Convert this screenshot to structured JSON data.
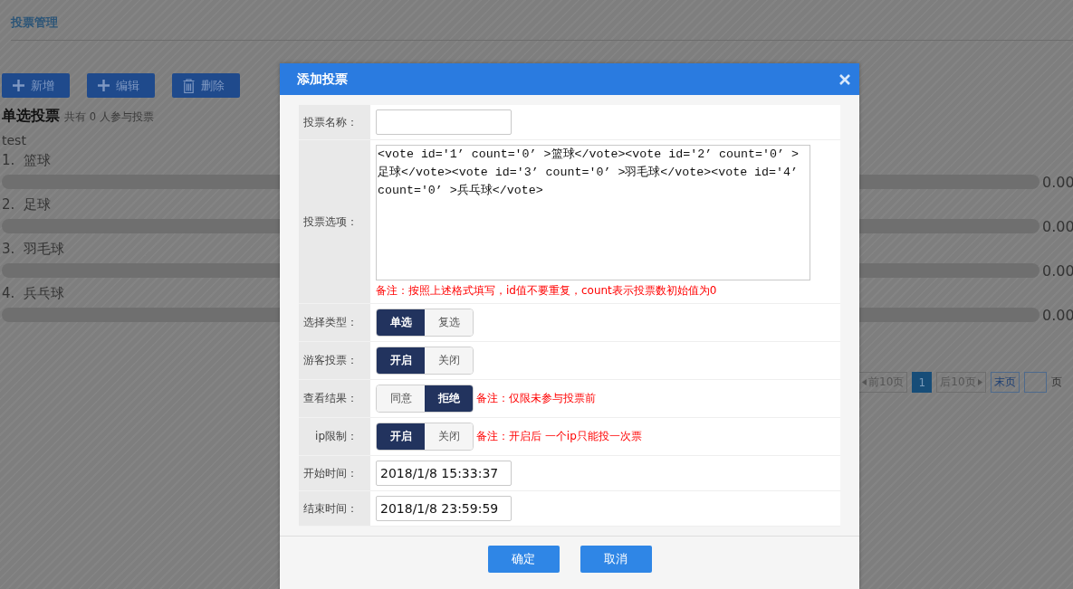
{
  "page": {
    "title": "投票管理"
  },
  "toolbar": [
    {
      "label": "新增",
      "kind": "add"
    },
    {
      "label": "编辑",
      "kind": "add"
    },
    {
      "label": "删除",
      "kind": "delete"
    }
  ],
  "poll": {
    "title": "单选投票",
    "summary": "共有 0 人参与投票",
    "name": "test",
    "options": [
      {
        "label": "1.  篮球",
        "level": 0,
        "reading": "0.00"
      },
      {
        "label": "2.  足球",
        "level": 0,
        "reading": "0.00"
      },
      {
        "label": "3.  羽毛球",
        "level": 0,
        "reading": "0.00"
      },
      {
        "label": "4.  兵乓球",
        "level": 0,
        "reading": "0.00"
      }
    ]
  },
  "pagination": {
    "prev": "前10页",
    "pages": [
      {
        "label": "1",
        "selected": true
      }
    ],
    "next": "后10页",
    "last": "末页",
    "suffix": "页"
  },
  "dialog": {
    "title": "添加投票",
    "fields": [
      {
        "kind": "text",
        "label": "投票名称："
      },
      {
        "kind": "textarea",
        "label": "投票选项：",
        "value": "<vote id='1’ count='0’ >篮球</vote><vote id='2’ count='0’ >足球</vote><vote id='3’ count='0’ >羽毛球</vote><vote id='4’ count='0’ >兵乓球</vote>",
        "note": "备注：按照上述格式填写，id值不要重复，count表示投票数初始值为0"
      },
      {
        "kind": "toggle",
        "label": "选择类型：",
        "options": [
          {
            "label": "单选",
            "selected": true
          },
          {
            "label": "复选",
            "selected": false
          }
        ]
      },
      {
        "kind": "toggle",
        "label": "游客投票：",
        "options": [
          {
            "label": "开启",
            "selected": true
          },
          {
            "label": "关闭",
            "selected": false
          }
        ]
      },
      {
        "kind": "toggle",
        "label": "查看结果：",
        "options": [
          {
            "label": "同意",
            "selected": false
          },
          {
            "label": "拒绝",
            "selected": true
          }
        ],
        "note": "备注：仅限未参与投票前"
      },
      {
        "kind": "toggle",
        "label": "ip限制：",
        "options": [
          {
            "label": "开启",
            "selected": true
          },
          {
            "label": "关闭",
            "selected": false
          }
        ],
        "note": "备注：开启后 一个ip只能投一次票"
      },
      {
        "kind": "text",
        "label": "开始时间：",
        "value": "2018/1/8 15:33:37"
      },
      {
        "kind": "text",
        "label": "结束时间：",
        "value": "2018/1/8 23:59:59"
      }
    ],
    "buttons": [
      "确定",
      "取消"
    ]
  }
}
